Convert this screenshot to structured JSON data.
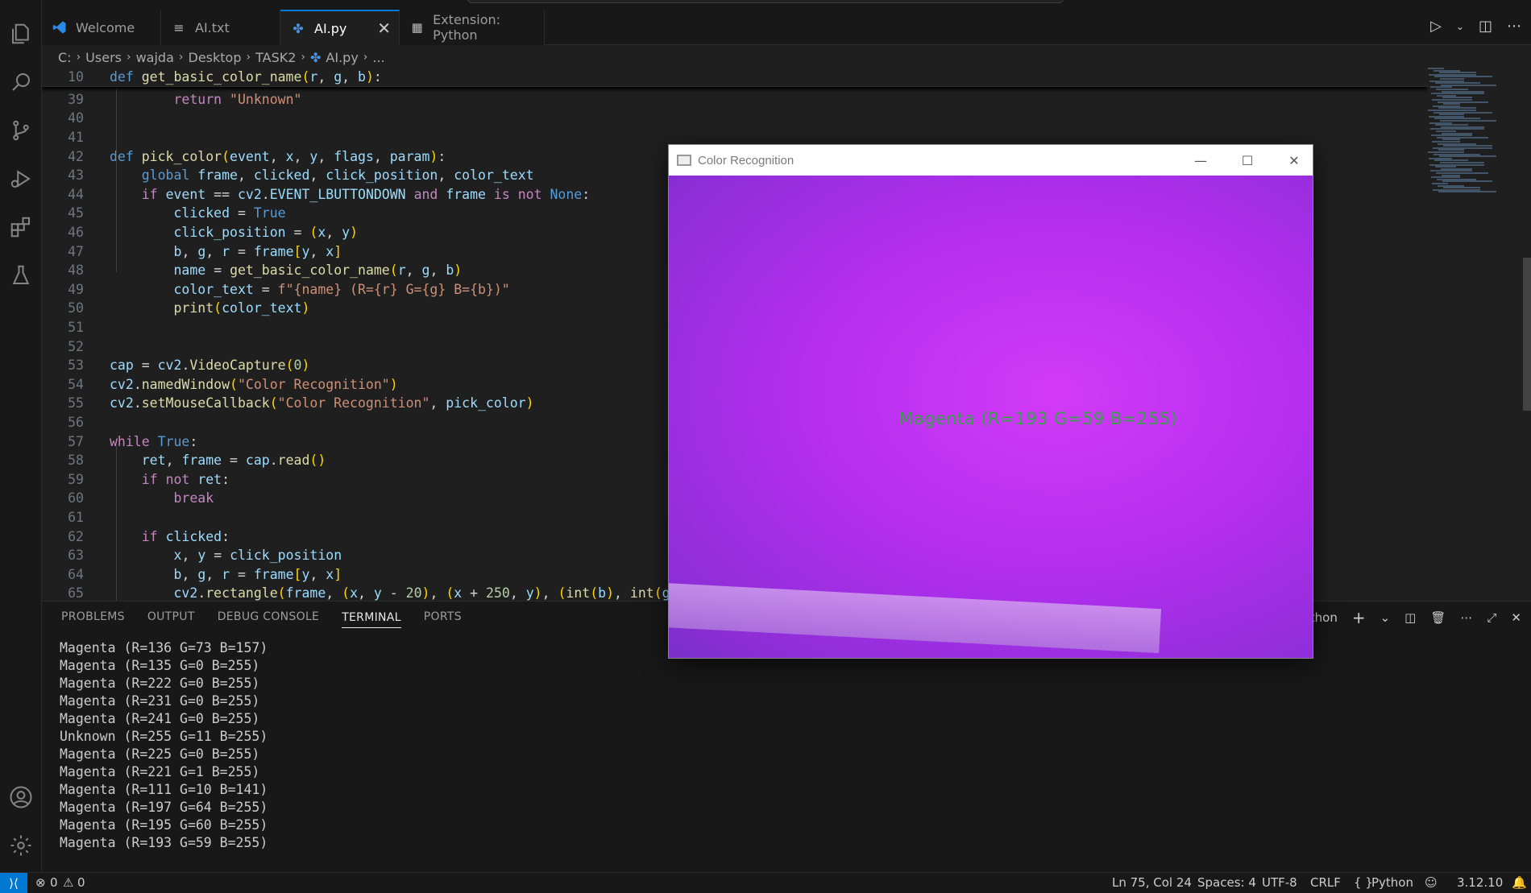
{
  "tabs": [
    {
      "label": "Welcome",
      "icon": "vscode-logo-icon"
    },
    {
      "label": "AI.txt",
      "icon": "text-file-icon"
    },
    {
      "label": "AI.py",
      "icon": "python-file-icon",
      "active": true
    },
    {
      "label": "Extension: Python",
      "icon": "extension-page-icon"
    }
  ],
  "breadcrumb": [
    "C:",
    "Users",
    "wajda",
    "Desktop",
    "TASK2",
    "AI.py",
    "..."
  ],
  "editor": {
    "lines": [
      {
        "n": "10",
        "text": "def get_basic_color_name(r, g, b):",
        "sticky": true
      },
      {
        "n": "39",
        "text": "        return \"Unknown\""
      },
      {
        "n": "40",
        "text": ""
      },
      {
        "n": "41",
        "text": ""
      },
      {
        "n": "42",
        "text": "def pick_color(event, x, y, flags, param):"
      },
      {
        "n": "43",
        "text": "    global frame, clicked, click_position, color_text"
      },
      {
        "n": "44",
        "text": "    if event == cv2.EVENT_LBUTTONDOWN and frame is not None:"
      },
      {
        "n": "45",
        "text": "        clicked = True"
      },
      {
        "n": "46",
        "text": "        click_position = (x, y)"
      },
      {
        "n": "47",
        "text": "        b, g, r = frame[y, x]"
      },
      {
        "n": "48",
        "text": "        name = get_basic_color_name(r, g, b)"
      },
      {
        "n": "49",
        "text": "        color_text = f\"{name} (R={r} G={g} B={b})\""
      },
      {
        "n": "50",
        "text": "        print(color_text)"
      },
      {
        "n": "51",
        "text": ""
      },
      {
        "n": "52",
        "text": ""
      },
      {
        "n": "53",
        "text": "cap = cv2.VideoCapture(0)"
      },
      {
        "n": "54",
        "text": "cv2.namedWindow(\"Color Recognition\")"
      },
      {
        "n": "55",
        "text": "cv2.setMouseCallback(\"Color Recognition\", pick_color)"
      },
      {
        "n": "56",
        "text": ""
      },
      {
        "n": "57",
        "text": "while True:"
      },
      {
        "n": "58",
        "text": "    ret, frame = cap.read()"
      },
      {
        "n": "59",
        "text": "    if not ret:"
      },
      {
        "n": "60",
        "text": "        break"
      },
      {
        "n": "61",
        "text": ""
      },
      {
        "n": "62",
        "text": "    if clicked:"
      },
      {
        "n": "63",
        "text": "        x, y = click_position"
      },
      {
        "n": "64",
        "text": "        b, g, r = frame[y, x]"
      },
      {
        "n": "65",
        "text": "        cv2.rectangle(frame, (x, y - 20), (x + 250, y), (int(b), int(g),"
      }
    ]
  },
  "panel": {
    "tabs": [
      "PROBLEMS",
      "OUTPUT",
      "DEBUG CONSOLE",
      "TERMINAL",
      "PORTS"
    ],
    "active_tab": "TERMINAL",
    "terminal_profile": "Python",
    "terminal_lines": [
      "Magenta (R=136 G=73 B=157)",
      "Magenta (R=135 G=0 B=255)",
      "Magenta (R=222 G=0 B=255)",
      "Magenta (R=231 G=0 B=255)",
      "Magenta (R=241 G=0 B=255)",
      "Unknown (R=255 G=11 B=255)",
      "Magenta (R=225 G=0 B=255)",
      "Magenta (R=221 G=1 B=255)",
      "Magenta (R=111 G=10 B=141)",
      "Magenta (R=197 G=64 B=255)",
      "Magenta (R=195 G=60 B=255)",
      "Magenta (R=193 G=59 B=255)"
    ]
  },
  "status": {
    "errors": "0",
    "warnings": "0",
    "cursor": "Ln 75, Col 24",
    "spaces": "Spaces: 4",
    "encoding": "UTF-8",
    "eol": "CRLF",
    "language": "Python",
    "language_prefix": "{ }",
    "python_version": "3.12.10"
  },
  "cv_window": {
    "title": "Color Recognition",
    "overlay_text": "Magenta (R=193 G=59 B=255)",
    "frame_color": "#c233f5",
    "overlay_color": "#37a148"
  },
  "colors": {
    "accent": "#0078d4",
    "editor_bg": "#1f1f1f",
    "panel_bg": "#181818"
  }
}
